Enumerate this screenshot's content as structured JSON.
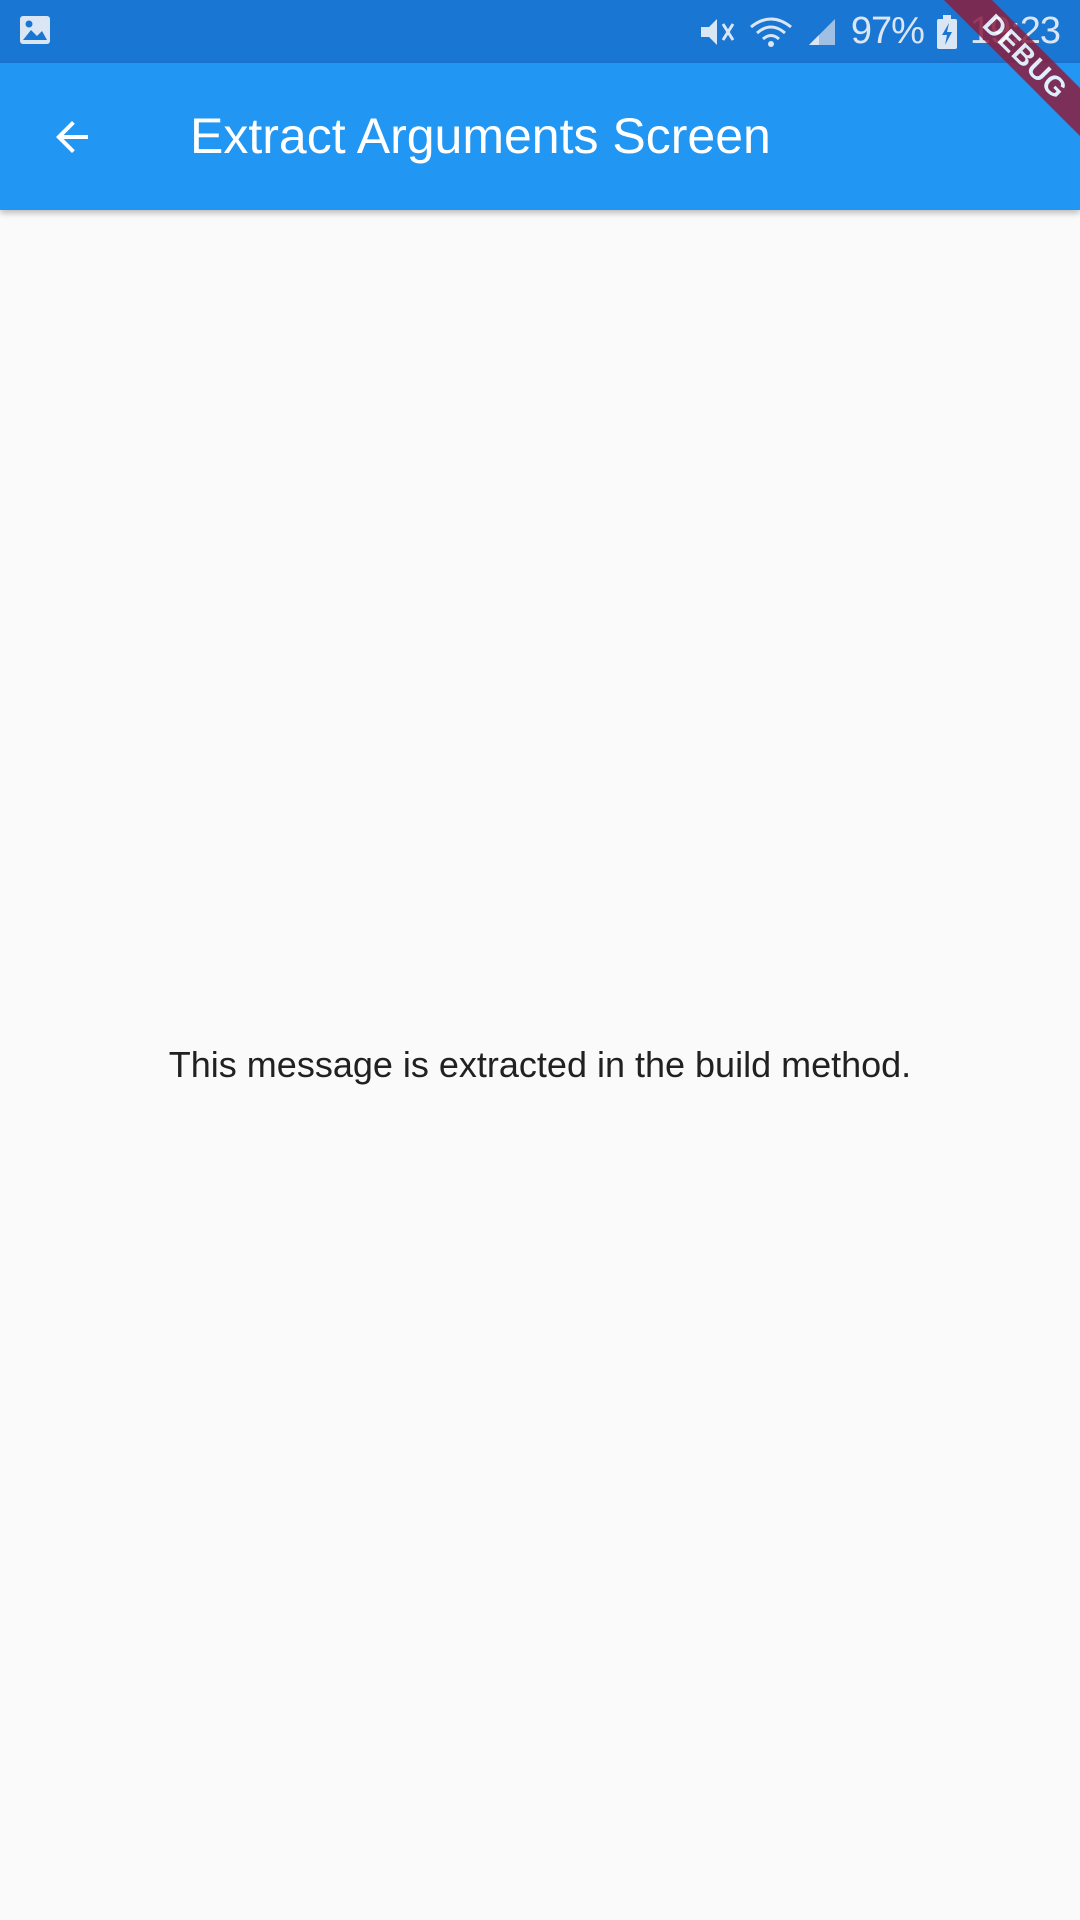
{
  "status_bar": {
    "left_icon": "image-notification-icon",
    "battery": "97%",
    "time": "19:23",
    "icons": [
      "vibrate-mute-icon",
      "wifi-icon",
      "cell-signal-icon",
      "battery-charging-icon"
    ]
  },
  "app_bar": {
    "title": "Extract Arguments Screen",
    "back_icon": "arrow-back-icon",
    "color": "#2196f3"
  },
  "debug_banner": {
    "label": "DEBUG"
  },
  "body": {
    "message": "This message is extracted in the build method."
  },
  "colors": {
    "status_bar": "#1976d2",
    "app_bar": "#2196f3",
    "background": "#fafafa",
    "debug_ribbon": "#8b1e3f"
  }
}
